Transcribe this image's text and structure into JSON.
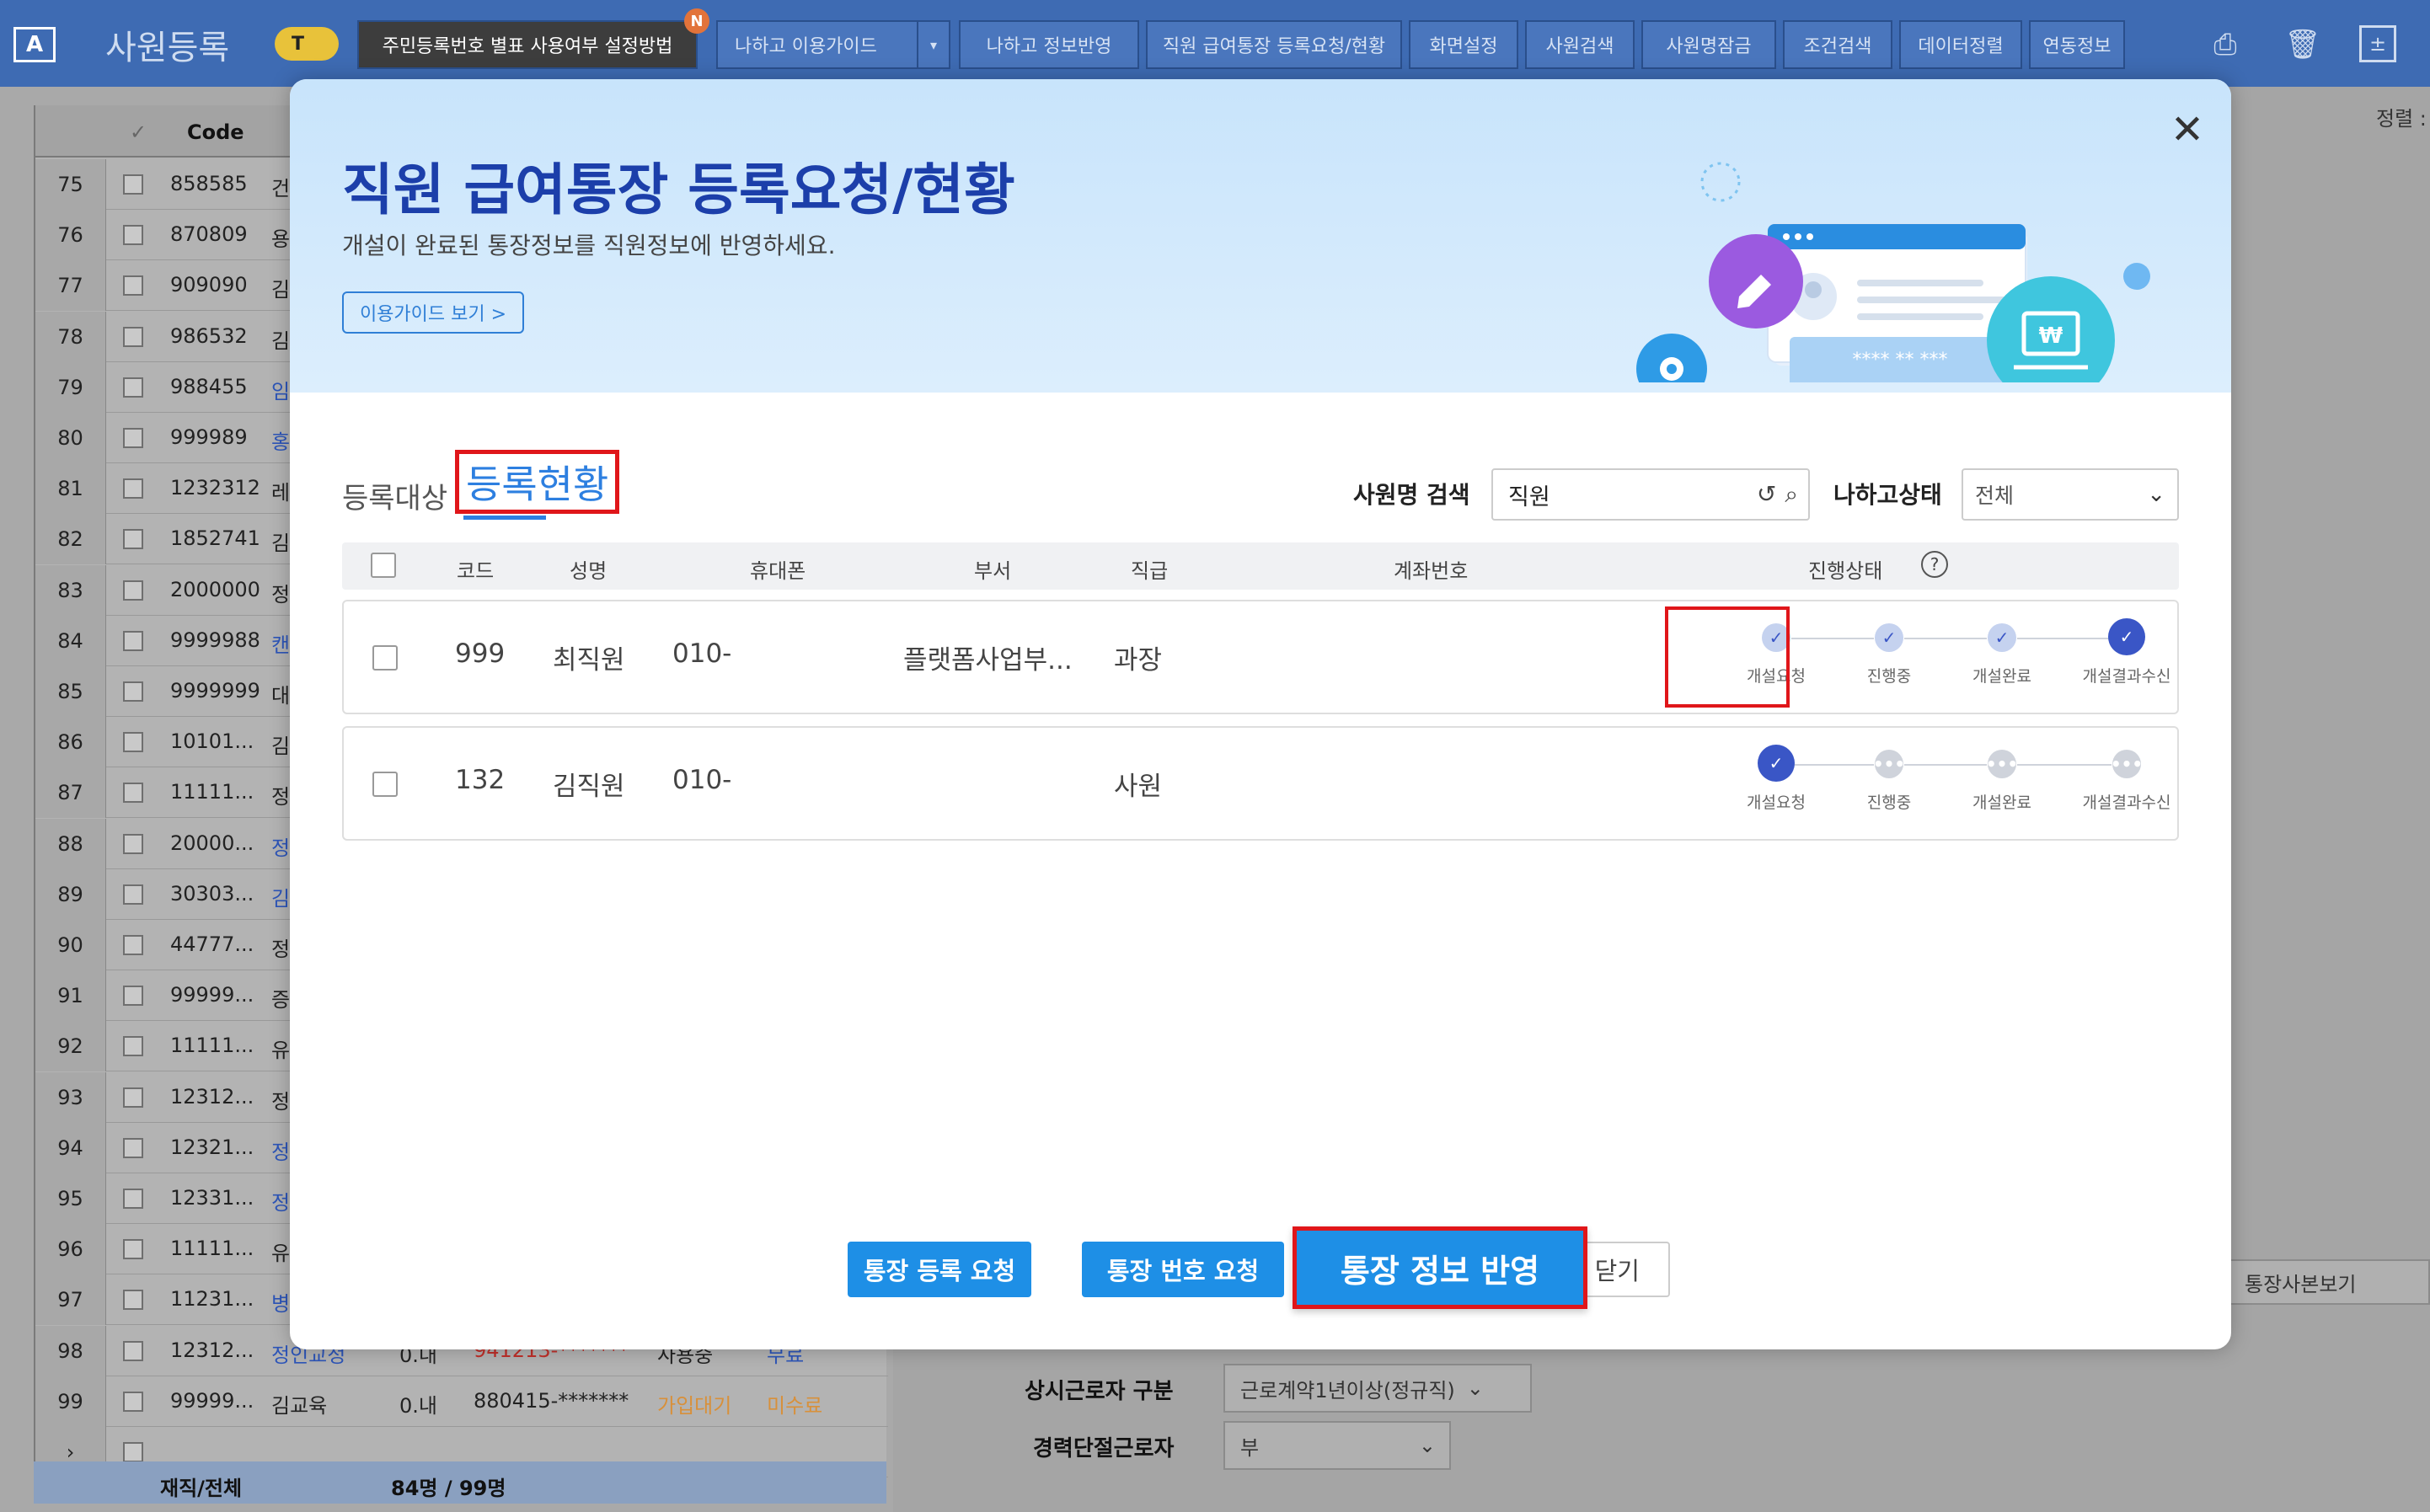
{
  "app": {
    "title": "사원등록",
    "icon": "letter-a-icon",
    "badge": "T"
  },
  "toolbar": {
    "btn1": "주민등록번호 별표 사용여부 설정방법",
    "new_badge": "N",
    "btn2": "나하고 이용가이드",
    "btn3": "나하고 정보반영",
    "btn4": "직원 급여통장 등록요청/현황",
    "btn5": "화면설정",
    "btn6": "사원검색",
    "btn7": "사원명잠금",
    "btn8": "조건검색",
    "btn9": "데이터정렬",
    "btn10": "연동정보",
    "icons": [
      "print-icon",
      "trash-icon",
      "calculator-icon"
    ]
  },
  "right_pane": {
    "sort_label": "정렬 :",
    "bankbook_copy": "통장사본보기",
    "field1_label": "상시근로자 구분",
    "field1_value": "근로계약1년이상(정규직)",
    "field2_label": "경력단절근로자",
    "field2_value": "부"
  },
  "grid": {
    "header_code": "Code",
    "rows": [
      {
        "no": "75",
        "code": "858585",
        "name": "건"
      },
      {
        "no": "76",
        "code": "870809",
        "name": "용"
      },
      {
        "no": "77",
        "code": "909090",
        "name": "김"
      },
      {
        "no": "78",
        "code": "986532",
        "name": "김"
      },
      {
        "no": "79",
        "code": "988455",
        "name": "임"
      },
      {
        "no": "80",
        "code": "999989",
        "name": "홍"
      },
      {
        "no": "81",
        "code": "1232312",
        "name": "레"
      },
      {
        "no": "82",
        "code": "1852741",
        "name": "김"
      },
      {
        "no": "83",
        "code": "2000000",
        "name": "정"
      },
      {
        "no": "84",
        "code": "9999988",
        "name": "캔"
      },
      {
        "no": "85",
        "code": "9999999",
        "name": "대"
      },
      {
        "no": "86",
        "code": "10101...",
        "name": "김"
      },
      {
        "no": "87",
        "code": "11111...",
        "name": "정"
      },
      {
        "no": "88",
        "code": "20000...",
        "name": "정"
      },
      {
        "no": "89",
        "code": "30303...",
        "name": "김"
      },
      {
        "no": "90",
        "code": "44777...",
        "name": "정"
      },
      {
        "no": "91",
        "code": "99999...",
        "name": "증"
      },
      {
        "no": "92",
        "code": "11111...",
        "name": "유"
      },
      {
        "no": "93",
        "code": "12312...",
        "name": "정"
      },
      {
        "no": "94",
        "code": "12321...",
        "name": "정"
      },
      {
        "no": "95",
        "code": "12331...",
        "name": "정"
      },
      {
        "no": "96",
        "code": "11111...",
        "name": "유"
      },
      {
        "no": "97",
        "code": "11231...",
        "name": "병"
      },
      {
        "no": "98",
        "code": "12312...",
        "name": "정인교정"
      },
      {
        "no": "99",
        "code": "99999...",
        "name": "김교육"
      }
    ],
    "row98_extra": {
      "c1": "0.내",
      "c2": "941213-*******",
      "c3": "사용중",
      "c4": "무료"
    },
    "row99_extra": {
      "c1": "0.내",
      "c2": "880415-*******",
      "c3": "가입대기",
      "c4": "미수료"
    },
    "footer_label": "재직/전체",
    "footer_count": "84명 / 99명"
  },
  "modal": {
    "title": "직원 급여통장 등록요청/현황",
    "subtitle": "개설이 완료된 통장정보를 직원정보에 반영하세요.",
    "guide_button": "이용가이드 보기 >",
    "tabs": {
      "tab1": "등록대상",
      "tab2": "등록현황"
    },
    "search_label": "사원명 검색",
    "search_value": "직원",
    "status_label": "나하고상태",
    "status_value": "전체",
    "illustration_mask": "**** ** ***",
    "illustration_won": "₩",
    "columns": {
      "code": "코드",
      "name": "성명",
      "phone": "휴대폰",
      "dept": "부서",
      "grade": "직급",
      "account": "계좌번호",
      "progress": "진행상태"
    },
    "steps": [
      "개설요청",
      "진행중",
      "개설완료",
      "개설결과수신"
    ],
    "rows": [
      {
        "code": "999",
        "name": "최직원",
        "phone": "010-",
        "dept": "플랫폼사업부...",
        "grade": "과장",
        "account": "",
        "progress": 4
      },
      {
        "code": "132",
        "name": "김직원",
        "phone": "010-",
        "dept": "",
        "grade": "사원",
        "account": "",
        "progress": 1
      }
    ],
    "buttons": {
      "register": "통장 등록 요청",
      "number": "통장 번호 요청",
      "reflect": "통장 정보 반영",
      "close": "닫기"
    }
  },
  "colors": {
    "accent": "#1e8fe6",
    "title": "#1c3faa",
    "highlight": "#e0161a",
    "step_done": "#3a56c6"
  }
}
